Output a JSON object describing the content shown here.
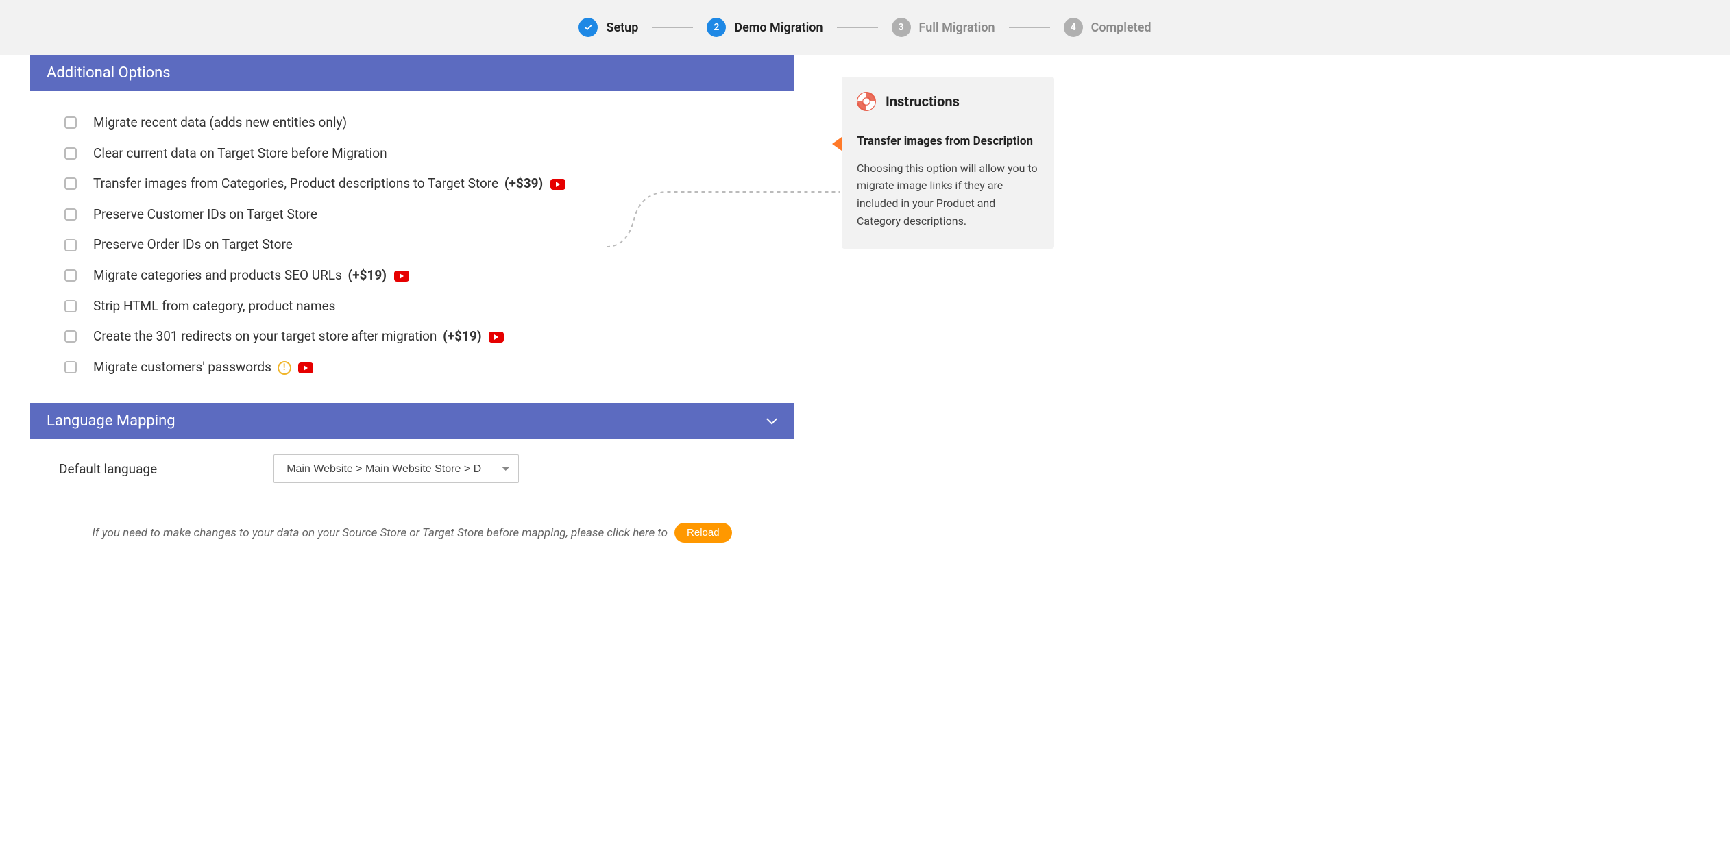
{
  "stepper": {
    "steps": [
      {
        "label": "Setup",
        "state": "done"
      },
      {
        "label": "Demo Migration",
        "state": "current",
        "num": "2"
      },
      {
        "label": "Full Migration",
        "state": "pending",
        "num": "3"
      },
      {
        "label": "Completed",
        "state": "pending",
        "num": "4"
      }
    ]
  },
  "sections": {
    "additional_options": {
      "title": "Additional Options",
      "items": [
        {
          "label": "Migrate recent data (adds new entities only)",
          "price": "",
          "yt": false,
          "warn": false
        },
        {
          "label": "Clear current data on Target Store before Migration",
          "price": "",
          "yt": false,
          "warn": false
        },
        {
          "label": "Transfer images from Categories, Product descriptions to Target Store",
          "price": "(+$39)",
          "yt": true,
          "warn": false
        },
        {
          "label": "Preserve Customer IDs on Target Store",
          "price": "",
          "yt": false,
          "warn": false
        },
        {
          "label": "Preserve Order IDs on Target Store",
          "price": "",
          "yt": false,
          "warn": false
        },
        {
          "label": "Migrate categories and products SEO URLs",
          "price": "(+$19)",
          "yt": true,
          "warn": false
        },
        {
          "label": "Strip HTML from category, product names",
          "price": "",
          "yt": false,
          "warn": false
        },
        {
          "label": "Create the 301 redirects on your target store after migration",
          "price": "(+$19)",
          "yt": true,
          "warn": false
        },
        {
          "label": "Migrate customers' passwords",
          "price": "",
          "yt": true,
          "warn": true
        }
      ]
    },
    "language_mapping": {
      "title": "Language Mapping",
      "default_label": "Default language",
      "select_value": "Main Website > Main Website Store > D",
      "note_prefix": "If you need to make changes to your data on your Source Store or Target Store before mapping, please click here to",
      "reload_label": "Reload"
    }
  },
  "sidebar": {
    "instructions_title": "Instructions",
    "card_title": "Transfer images from Description",
    "card_body": "Choosing this option will allow you to migrate image links if they are included in your Product and Category descriptions."
  }
}
